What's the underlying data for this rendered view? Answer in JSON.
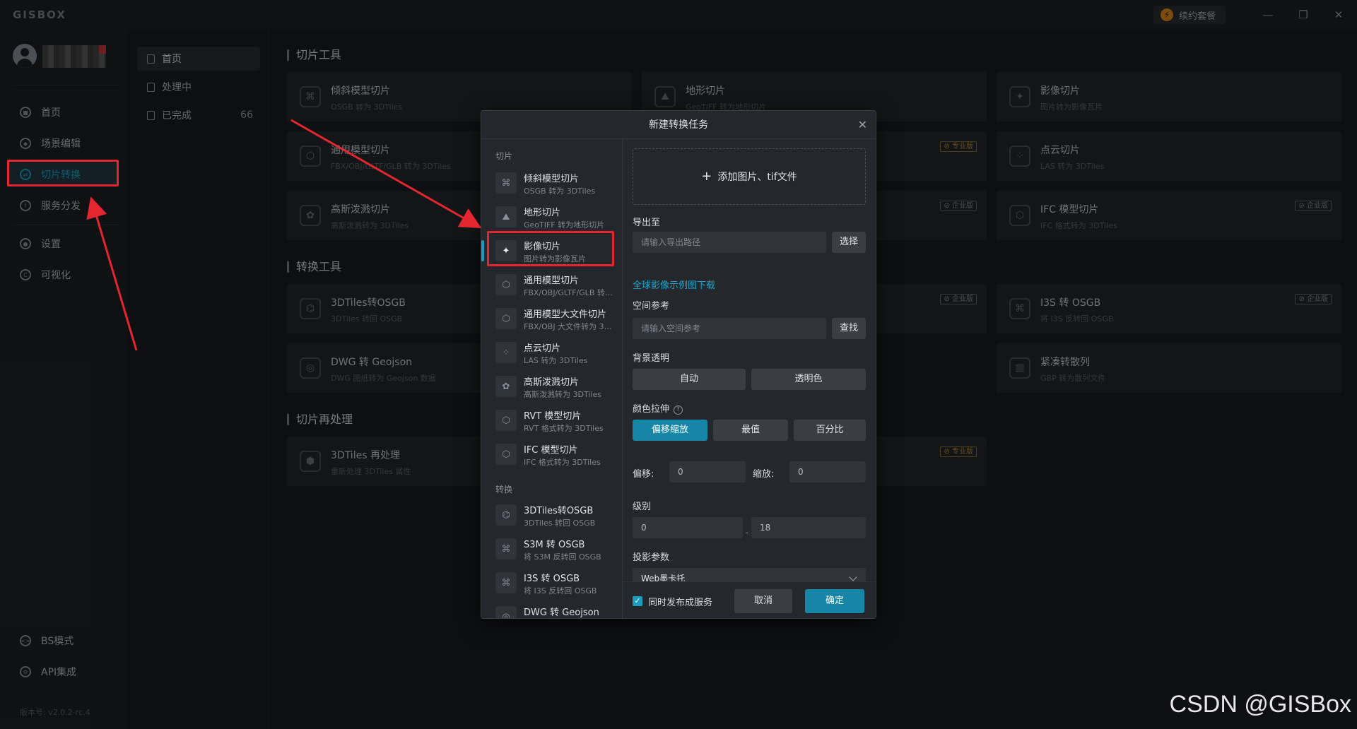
{
  "window": {
    "brand": "GISBOX",
    "renew_label": "续约套餐",
    "minimize": "—",
    "restore": "❐",
    "close": "✕"
  },
  "sidebar": {
    "items": [
      {
        "label": "首页",
        "icon": "home-icon"
      },
      {
        "label": "场景编辑",
        "icon": "cube-icon"
      },
      {
        "label": "切片转换",
        "icon": "convert-icon"
      },
      {
        "label": "服务分发",
        "icon": "upload-icon"
      },
      {
        "label": "设置",
        "icon": "gear-icon"
      },
      {
        "label": "可视化",
        "icon": "visual-icon"
      }
    ],
    "bottom_items": [
      {
        "label": "BS模式",
        "icon": "code-icon"
      },
      {
        "label": "API集成",
        "icon": "api-icon"
      }
    ],
    "version": "版本号: v2.0.2-rc.4"
  },
  "subnav": {
    "items": [
      {
        "label": "首页",
        "count": ""
      },
      {
        "label": "处理中",
        "count": ""
      },
      {
        "label": "已完成",
        "count": "66"
      }
    ]
  },
  "main": {
    "section_slice": "切片工具",
    "section_convert": "转换工具",
    "section_reprocess": "切片再处理",
    "cards": [
      {
        "name": "倾斜模型切片",
        "desc": "OSGB 转为 3DTiles",
        "badge": ""
      },
      {
        "name": "地形切片",
        "desc": "GeoTIFF 转为地形切片",
        "badge": ""
      },
      {
        "name": "影像切片",
        "desc": "图片转为影像瓦片",
        "badge": ""
      },
      {
        "name": "通用模型切片",
        "desc": "FBX/OBJ/GLTF/GLB 转为 3DTiles",
        "badge": ""
      },
      {
        "name": "",
        "desc": "",
        "badge": "专业版"
      },
      {
        "name": "点云切片",
        "desc": "LAS 转为 3DTiles",
        "badge": ""
      },
      {
        "name": "高斯泼溅切片",
        "desc": "高斯泼溅转为 3DTiles",
        "badge": ""
      },
      {
        "name": "",
        "desc": "",
        "badge": "企业版"
      },
      {
        "name": "IFC 模型切片",
        "desc": "IFC 格式转为 3DTiles",
        "badge": "企业版"
      },
      {
        "name": "3DTiles转OSGB",
        "desc": "3DTiles 转回 OSGB",
        "badge": ""
      },
      {
        "name": "",
        "desc": "",
        "badge": "企业版"
      },
      {
        "name": "I3S 转 OSGB",
        "desc": "将 I3S 反转回 OSGB",
        "badge": "企业版"
      },
      {
        "name": "DWG 转 Geojson",
        "desc": "DWG 图纸转为 Geojson 数据",
        "badge": ""
      },
      {
        "name": "紧凑转散列",
        "desc": "GBP 转为散列文件",
        "badge": ""
      },
      {
        "name": "3DTiles 再处理",
        "desc": "重新处理 3DTiles 属性",
        "badge": ""
      },
      {
        "name": "",
        "desc": "",
        "badge": "专业版"
      }
    ]
  },
  "dialog": {
    "title": "新建转换任务",
    "close": "✕",
    "group_slice": "切片",
    "group_convert": "转换",
    "tools": [
      {
        "name": "倾斜模型切片",
        "desc": "OSGB 转为 3DTiles"
      },
      {
        "name": "地形切片",
        "desc": "GeoTIFF 转为地形切片"
      },
      {
        "name": "影像切片",
        "desc": "图片转为影像瓦片"
      },
      {
        "name": "通用模型切片",
        "desc": "FBX/OBJ/GLTF/GLB 转为 3DTiles"
      },
      {
        "name": "通用模型大文件切片",
        "desc": "FBX/OBJ 大文件转为 3DTiles"
      },
      {
        "name": "点云切片",
        "desc": "LAS 转为 3DTiles"
      },
      {
        "name": "高斯泼溅切片",
        "desc": "高斯泼溅转为 3DTiles"
      },
      {
        "name": "RVT 模型切片",
        "desc": "RVT 格式转为 3DTiles"
      },
      {
        "name": "IFC 模型切片",
        "desc": "IFC 格式转为 3DTiles"
      }
    ],
    "convert_tools": [
      {
        "name": "3DTiles转OSGB",
        "desc": "3DTiles 转回 OSGB"
      },
      {
        "name": "S3M 转 OSGB",
        "desc": "将 S3M 反转回 OSGB"
      },
      {
        "name": "I3S 转 OSGB",
        "desc": "将 I3S 反转回 OSGB"
      },
      {
        "name": "DWG 转 Geojson",
        "desc": ""
      }
    ],
    "add_files": "添加图片、tif文件",
    "export_label": "导出至",
    "export_placeholder": "请输入导出路径",
    "select_btn": "选择",
    "sample_link": "全球影像示例图下载",
    "srs_label": "空间参考",
    "srs_placeholder": "请输入空间参考",
    "find_btn": "查找",
    "bg_label": "背景透明",
    "bg_options": [
      "自动",
      "透明色"
    ],
    "stretch_label": "颜色拉伸",
    "stretch_options": [
      "偏移缩放",
      "最值",
      "百分比"
    ],
    "offset_label": "偏移:",
    "offset_value": "0",
    "scale_label": "缩放:",
    "scale_value": "0",
    "level_label": "级别",
    "level_min": "0",
    "level_max": "18",
    "level_sep": "-",
    "proj_label": "投影参数",
    "proj_value": "Web墨卡托",
    "publish_label": "同时发布成服务",
    "cancel_btn": "取消",
    "ok_btn": "确定"
  },
  "watermark": "CSDN @GISBox",
  "colors": {
    "accent": "#1b9bbd",
    "annotation": "#e3262f"
  }
}
